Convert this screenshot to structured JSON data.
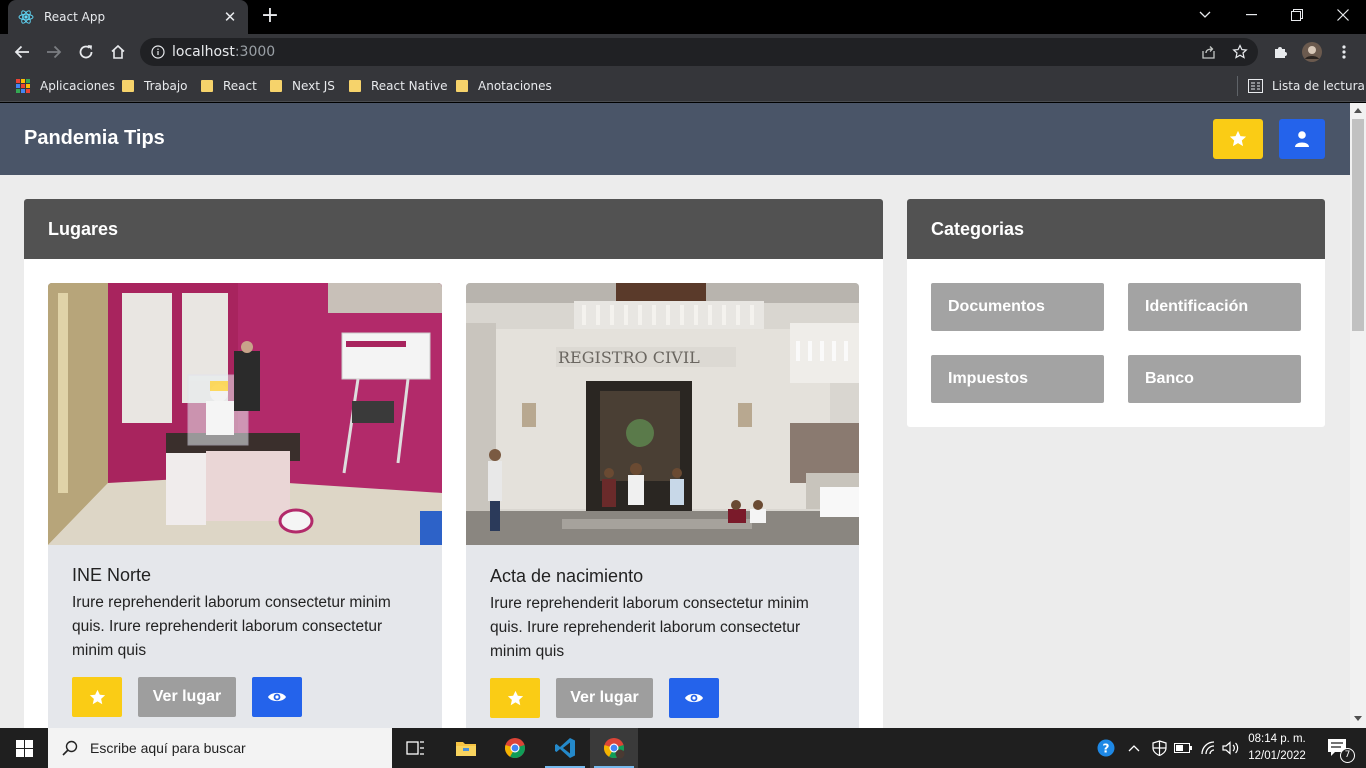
{
  "browser": {
    "tab_title": "React App",
    "url_host": "localhost",
    "url_port": ":3000",
    "bookmarks": [
      "Aplicaciones",
      "Trabajo",
      "React",
      "Next JS",
      "React Native",
      "Anotaciones"
    ],
    "reading_list": "Lista de lectura"
  },
  "app": {
    "brand": "Pandemia Tips",
    "colors": {
      "navbar": "#4a5568",
      "favorite": "#facc15",
      "primary": "#2463eb",
      "panel_header": "#525252"
    }
  },
  "lugares": {
    "title": "Lugares",
    "cards": [
      {
        "title": "INE Norte",
        "description": "Irure reprehenderit laborum consectetur minim quis. Irure reprehenderit laborum consectetur minim quis",
        "view_label": "Ver lugar"
      },
      {
        "title": "Acta de nacimiento",
        "description": "Irure reprehenderit laborum consectetur minim quis. Irure reprehenderit laborum consectetur minim quis",
        "view_label": "Ver lugar"
      }
    ]
  },
  "categorias": {
    "title": "Categorias",
    "items": [
      "Documentos",
      "Identificación",
      "Impuestos",
      "Banco"
    ]
  },
  "taskbar": {
    "search_placeholder": "Escribe aquí para buscar",
    "time": "08:14 p. m.",
    "date": "12/01/2022",
    "notifications": "7"
  }
}
